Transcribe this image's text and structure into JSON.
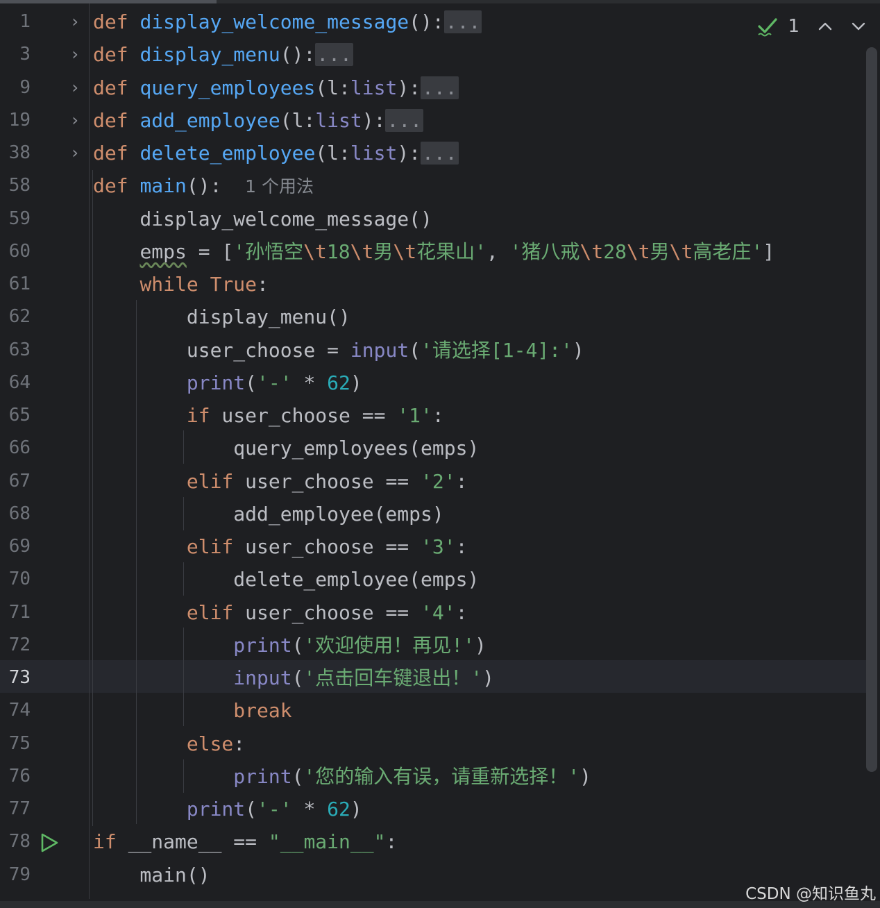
{
  "editor": {
    "current_line": "73",
    "inspection": {
      "count": "1",
      "check_color": "#5fb865"
    },
    "watermark": "CSDN @知识鱼丸"
  },
  "lines": [
    {
      "num": "1",
      "folded": true,
      "tokens": [
        {
          "t": "def",
          "c": "kw"
        },
        {
          "t": " "
        },
        {
          "t": "display_welcome_message",
          "c": "fn"
        },
        {
          "t": "():"
        },
        {
          "t": "...",
          "c": "fold-placeholder"
        }
      ]
    },
    {
      "num": "3",
      "folded": true,
      "tokens": [
        {
          "t": "def",
          "c": "kw"
        },
        {
          "t": " "
        },
        {
          "t": "display_menu",
          "c": "fn"
        },
        {
          "t": "():"
        },
        {
          "t": "...",
          "c": "fold-placeholder"
        }
      ]
    },
    {
      "num": "9",
      "folded": true,
      "tokens": [
        {
          "t": "def",
          "c": "kw"
        },
        {
          "t": " "
        },
        {
          "t": "query_employees",
          "c": "fn"
        },
        {
          "t": "(l:"
        },
        {
          "t": "list",
          "c": "bi"
        },
        {
          "t": "):"
        },
        {
          "t": "...",
          "c": "fold-placeholder"
        }
      ]
    },
    {
      "num": "19",
      "folded": true,
      "tokens": [
        {
          "t": "def",
          "c": "kw"
        },
        {
          "t": " "
        },
        {
          "t": "add_employee",
          "c": "fn"
        },
        {
          "t": "(l:"
        },
        {
          "t": "list",
          "c": "bi"
        },
        {
          "t": "):"
        },
        {
          "t": "...",
          "c": "fold-placeholder"
        }
      ]
    },
    {
      "num": "38",
      "folded": true,
      "tokens": [
        {
          "t": "def",
          "c": "kw"
        },
        {
          "t": " "
        },
        {
          "t": "delete_employee",
          "c": "fn"
        },
        {
          "t": "(l:"
        },
        {
          "t": "list",
          "c": "bi"
        },
        {
          "t": "):"
        },
        {
          "t": "...",
          "c": "fold-placeholder"
        }
      ]
    },
    {
      "num": "58",
      "tokens": [
        {
          "t": "def",
          "c": "kw"
        },
        {
          "t": " "
        },
        {
          "t": "main",
          "c": "fn"
        },
        {
          "t": "():  "
        },
        {
          "t": "1 个用法",
          "c": "hint"
        }
      ]
    },
    {
      "num": "59",
      "tokens": [
        {
          "t": "    display_welcome_message()"
        }
      ]
    },
    {
      "num": "60",
      "tokens": [
        {
          "t": "    "
        },
        {
          "t": "emps",
          "c": "warn-underline"
        },
        {
          "t": " = ["
        },
        {
          "t": "'孙悟空",
          "c": "str"
        },
        {
          "t": "\\t",
          "c": "esc"
        },
        {
          "t": "18",
          "c": "str"
        },
        {
          "t": "\\t",
          "c": "esc"
        },
        {
          "t": "男",
          "c": "str"
        },
        {
          "t": "\\t",
          "c": "esc"
        },
        {
          "t": "花果山'",
          "c": "str"
        },
        {
          "t": ", "
        },
        {
          "t": "'猪八戒",
          "c": "str"
        },
        {
          "t": "\\t",
          "c": "esc"
        },
        {
          "t": "28",
          "c": "str"
        },
        {
          "t": "\\t",
          "c": "esc"
        },
        {
          "t": "男",
          "c": "str"
        },
        {
          "t": "\\t",
          "c": "esc"
        },
        {
          "t": "高老庄'",
          "c": "str"
        },
        {
          "t": "]"
        }
      ]
    },
    {
      "num": "61",
      "tokens": [
        {
          "t": "    "
        },
        {
          "t": "while",
          "c": "kw"
        },
        {
          "t": " "
        },
        {
          "t": "True",
          "c": "kw"
        },
        {
          "t": ":"
        }
      ]
    },
    {
      "num": "62",
      "tokens": [
        {
          "t": "        display_menu()"
        }
      ]
    },
    {
      "num": "63",
      "tokens": [
        {
          "t": "        user_choose = "
        },
        {
          "t": "input",
          "c": "bi"
        },
        {
          "t": "("
        },
        {
          "t": "'请选择[1-4]:'",
          "c": "str"
        },
        {
          "t": ")"
        }
      ]
    },
    {
      "num": "64",
      "tokens": [
        {
          "t": "        "
        },
        {
          "t": "print",
          "c": "bi"
        },
        {
          "t": "("
        },
        {
          "t": "'-'",
          "c": "str"
        },
        {
          "t": " * "
        },
        {
          "t": "62",
          "c": "num"
        },
        {
          "t": ")"
        }
      ]
    },
    {
      "num": "65",
      "tokens": [
        {
          "t": "        "
        },
        {
          "t": "if",
          "c": "kw"
        },
        {
          "t": " user_choose == "
        },
        {
          "t": "'1'",
          "c": "str"
        },
        {
          "t": ":"
        }
      ]
    },
    {
      "num": "66",
      "tokens": [
        {
          "t": "            query_employees(emps)"
        }
      ]
    },
    {
      "num": "67",
      "tokens": [
        {
          "t": "        "
        },
        {
          "t": "elif",
          "c": "kw"
        },
        {
          "t": " user_choose == "
        },
        {
          "t": "'2'",
          "c": "str"
        },
        {
          "t": ":"
        }
      ]
    },
    {
      "num": "68",
      "tokens": [
        {
          "t": "            add_employee(emps)"
        }
      ]
    },
    {
      "num": "69",
      "tokens": [
        {
          "t": "        "
        },
        {
          "t": "elif",
          "c": "kw"
        },
        {
          "t": " user_choose == "
        },
        {
          "t": "'3'",
          "c": "str"
        },
        {
          "t": ":"
        }
      ]
    },
    {
      "num": "70",
      "tokens": [
        {
          "t": "            delete_employee(emps)"
        }
      ]
    },
    {
      "num": "71",
      "tokens": [
        {
          "t": "        "
        },
        {
          "t": "elif",
          "c": "kw"
        },
        {
          "t": " user_choose == "
        },
        {
          "t": "'4'",
          "c": "str"
        },
        {
          "t": ":"
        }
      ]
    },
    {
      "num": "72",
      "tokens": [
        {
          "t": "            "
        },
        {
          "t": "print",
          "c": "bi"
        },
        {
          "t": "("
        },
        {
          "t": "'欢迎使用！再见!'",
          "c": "str"
        },
        {
          "t": ")"
        }
      ]
    },
    {
      "num": "73",
      "tokens": [
        {
          "t": "            "
        },
        {
          "t": "input",
          "c": "bi"
        },
        {
          "t": "("
        },
        {
          "t": "'点击回车键退出！'",
          "c": "str"
        },
        {
          "t": ")"
        }
      ]
    },
    {
      "num": "74",
      "tokens": [
        {
          "t": "            "
        },
        {
          "t": "break",
          "c": "kw"
        }
      ]
    },
    {
      "num": "75",
      "tokens": [
        {
          "t": "        "
        },
        {
          "t": "else",
          "c": "kw"
        },
        {
          "t": ":"
        }
      ]
    },
    {
      "num": "76",
      "tokens": [
        {
          "t": "            "
        },
        {
          "t": "print",
          "c": "bi"
        },
        {
          "t": "("
        },
        {
          "t": "'您的输入有误，请重新选择！'",
          "c": "str"
        },
        {
          "t": ")"
        }
      ]
    },
    {
      "num": "77",
      "tokens": [
        {
          "t": "        "
        },
        {
          "t": "print",
          "c": "bi"
        },
        {
          "t": "("
        },
        {
          "t": "'-'",
          "c": "str"
        },
        {
          "t": " * "
        },
        {
          "t": "62",
          "c": "num"
        },
        {
          "t": ")"
        }
      ]
    },
    {
      "num": "78",
      "run": true,
      "tokens": [
        {
          "t": "if",
          "c": "kw"
        },
        {
          "t": " __name__ == "
        },
        {
          "t": "\"__main__\"",
          "c": "str"
        },
        {
          "t": ":"
        }
      ]
    },
    {
      "num": "79",
      "tokens": [
        {
          "t": "    main()"
        }
      ]
    }
  ]
}
